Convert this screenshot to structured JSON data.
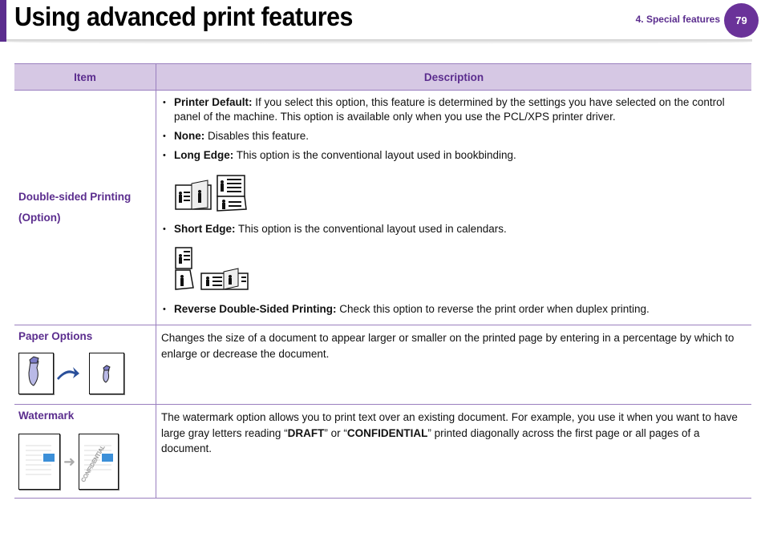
{
  "header": {
    "title": "Using advanced print features",
    "section": "4.  Special features",
    "page_number": "79"
  },
  "table": {
    "columns": [
      "Item",
      "Description"
    ],
    "rows": [
      {
        "item": "Double-sided Printing (Option)",
        "item_line1": "Double-sided Printing",
        "item_line2": "(Option)",
        "bullets": [
          {
            "term": "Printer Default:",
            "text": " If you select this option, this feature is determined by the settings you have selected on the control panel of the machine. This option is available only when you use the PCL/XPS printer driver."
          },
          {
            "term": "None:",
            "text": " Disables this feature."
          },
          {
            "term": "Long Edge:",
            "text": " This option is the conventional layout used in bookbinding."
          },
          {
            "term": "Short Edge:",
            "text": " This option is the conventional layout used in calendars."
          },
          {
            "term": "Reverse Double-Sided Printing:",
            "text": " Check this option to reverse the print order when duplex printing."
          }
        ],
        "icons": [
          "long-edge-binding-icon",
          "short-edge-binding-icon"
        ]
      },
      {
        "item": "Paper Options",
        "description": "Changes the size of a document to appear larger or smaller on the printed page by entering in a percentage by which to enlarge or decrease the document.",
        "icons": [
          "scale-document-icon"
        ]
      },
      {
        "item": "Watermark",
        "description_parts": [
          "The watermark option allows you to print text over an existing document. For example, you use it when you want to have large gray letters reading “",
          "DRAFT",
          "” or “",
          "CONFIDENTIAL",
          "” printed diagonally across the first page or all pages of a document."
        ],
        "watermark_sample": "CONFIDENTIAL",
        "icons": [
          "watermark-icon"
        ]
      }
    ]
  },
  "colors": {
    "accent": "#5b2d8e",
    "header_bg": "#d6c8e4"
  }
}
